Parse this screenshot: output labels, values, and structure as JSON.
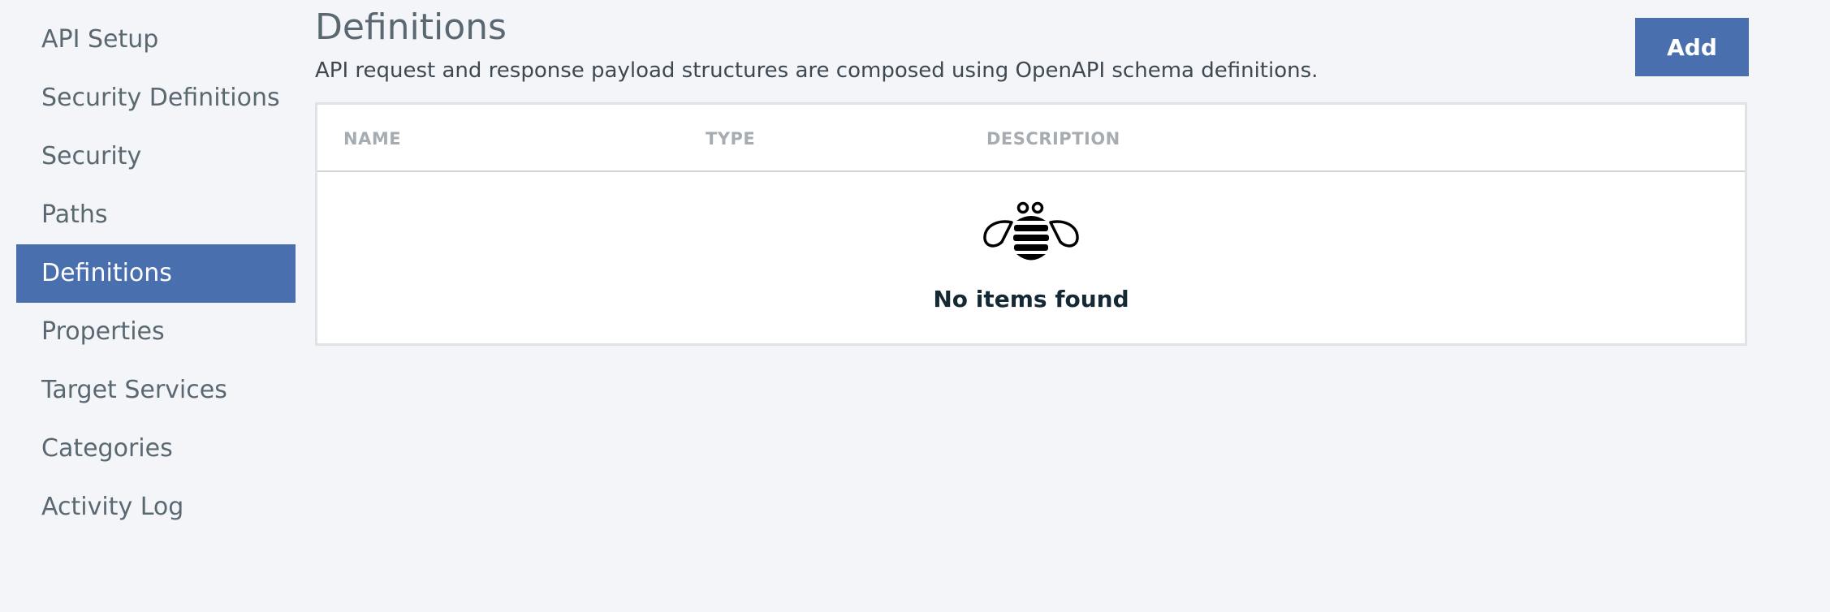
{
  "sidebar": {
    "items": [
      {
        "label": "API Setup",
        "active": false
      },
      {
        "label": "Security Definitions",
        "active": false
      },
      {
        "label": "Security",
        "active": false
      },
      {
        "label": "Paths",
        "active": false
      },
      {
        "label": "Definitions",
        "active": true
      },
      {
        "label": "Properties",
        "active": false
      },
      {
        "label": "Target Services",
        "active": false
      },
      {
        "label": "Categories",
        "active": false
      },
      {
        "label": "Activity Log",
        "active": false
      }
    ]
  },
  "main": {
    "title": "Definitions",
    "description": "API request and response payload structures are composed using OpenAPI schema definitions.",
    "add_label": "Add",
    "table": {
      "columns": [
        "NAME",
        "TYPE",
        "DESCRIPTION"
      ],
      "empty_icon": "bee-icon",
      "empty_text": "No items found"
    }
  },
  "colors": {
    "accent": "#4a6fae",
    "background": "#f4f5f8",
    "text": "#5a6872"
  }
}
